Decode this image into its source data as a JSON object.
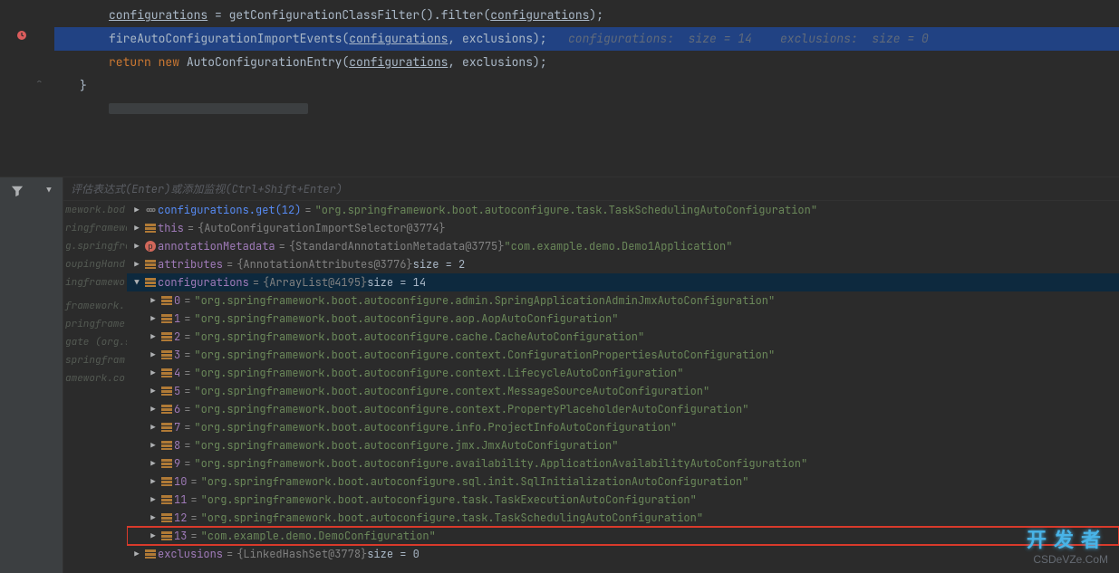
{
  "editor": {
    "line1": {
      "t1": "configurations",
      "t2": " = getConfigurationClassFilter().filter(",
      "t3": "configurations",
      "t4": ");"
    },
    "line2": {
      "t1": "fireAutoConfigurationImportEvents(",
      "t2": "configurations",
      "t3": ", exclusions);",
      "hint": "   configurations:  size = 14    exclusions:  size = 0"
    },
    "line3": {
      "t1": "return ",
      "t2": "new ",
      "t3": "AutoConfigurationEntry(",
      "t4": "configurations",
      "t5": ", exclusions);"
    },
    "line4": "}"
  },
  "debug": {
    "evalPlaceholder": "评估表达式(Enter)或添加监视(Ctrl+Shift+Enter)",
    "frames": [
      "mework.bod",
      "ringframewo",
      "g.springfra",
      "oupingHand",
      "ingframewo",
      "",
      "framework.",
      "pringframe",
      "gate (org.s",
      "springfram",
      "amework.co"
    ],
    "watch": {
      "name": "configurations.get(12)",
      "eq": " = ",
      "val": "\"org.springframework.boot.autoconfigure.task.TaskSchedulingAutoConfiguration\""
    },
    "thisv": {
      "name": "this",
      "eq": " = ",
      "obj": "{AutoConfigurationImportSelector@3774}"
    },
    "ann": {
      "name": "annotationMetadata",
      "eq": " = ",
      "obj": "{StandardAnnotationMetadata@3775}",
      "str": " \"com.example.demo.Demo1Application\""
    },
    "attr": {
      "name": "attributes",
      "eq": " = ",
      "obj": "{AnnotationAttributes@3776}",
      "sz": "  size = 2"
    },
    "conf": {
      "name": "configurations",
      "eq": " = ",
      "obj": "{ArrayList@4195}",
      "sz": "  size = 14"
    },
    "items": [
      {
        "i": "0",
        "v": "\"org.springframework.boot.autoconfigure.admin.SpringApplicationAdminJmxAutoConfiguration\""
      },
      {
        "i": "1",
        "v": "\"org.springframework.boot.autoconfigure.aop.AopAutoConfiguration\""
      },
      {
        "i": "2",
        "v": "\"org.springframework.boot.autoconfigure.cache.CacheAutoConfiguration\""
      },
      {
        "i": "3",
        "v": "\"org.springframework.boot.autoconfigure.context.ConfigurationPropertiesAutoConfiguration\""
      },
      {
        "i": "4",
        "v": "\"org.springframework.boot.autoconfigure.context.LifecycleAutoConfiguration\""
      },
      {
        "i": "5",
        "v": "\"org.springframework.boot.autoconfigure.context.MessageSourceAutoConfiguration\""
      },
      {
        "i": "6",
        "v": "\"org.springframework.boot.autoconfigure.context.PropertyPlaceholderAutoConfiguration\""
      },
      {
        "i": "7",
        "v": "\"org.springframework.boot.autoconfigure.info.ProjectInfoAutoConfiguration\""
      },
      {
        "i": "8",
        "v": "\"org.springframework.boot.autoconfigure.jmx.JmxAutoConfiguration\""
      },
      {
        "i": "9",
        "v": "\"org.springframework.boot.autoconfigure.availability.ApplicationAvailabilityAutoConfiguration\""
      },
      {
        "i": "10",
        "v": "\"org.springframework.boot.autoconfigure.sql.init.SqlInitializationAutoConfiguration\""
      },
      {
        "i": "11",
        "v": "\"org.springframework.boot.autoconfigure.task.TaskExecutionAutoConfiguration\""
      },
      {
        "i": "12",
        "v": "\"org.springframework.boot.autoconfigure.task.TaskSchedulingAutoConfiguration\""
      },
      {
        "i": "13",
        "v": "\"com.example.demo.DemoConfiguration\"",
        "hi": true
      }
    ],
    "excl": {
      "name": "exclusions",
      "eq": " = ",
      "obj": "{LinkedHashSet@3778}",
      "sz": "  size = 0"
    }
  },
  "watermark": {
    "cn": "开发者",
    "en": "CSDeVZe.CoM"
  }
}
